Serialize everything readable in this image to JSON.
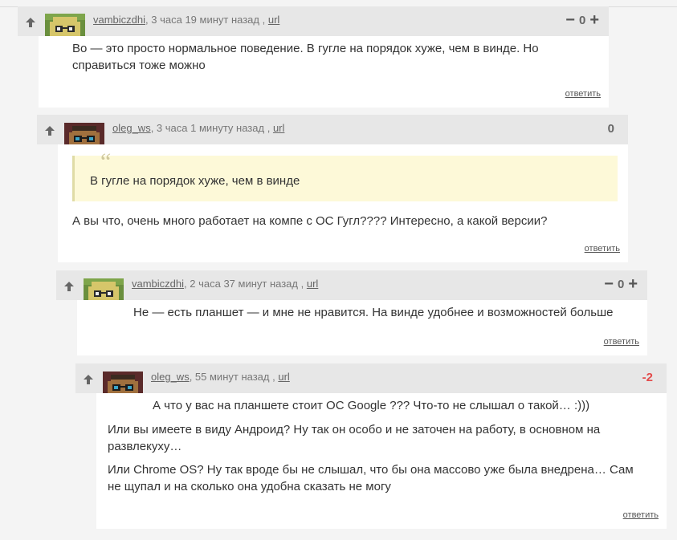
{
  "comments": [
    {
      "user": "vambiczdhi",
      "time": ", 3 часа 19 минут назад ,",
      "url": "url",
      "rating": "0",
      "has_vote_buttons": true,
      "paragraphs": [
        "Во — это просто нормальное поведение. В гугле на порядок хуже, чем в винде. Но справиться тоже можно"
      ],
      "reply": "ответить",
      "avatar": "yellow-glasses-avatar"
    },
    {
      "user": "oleg_ws",
      "time": ", 3 часа 1 минуту назад ,",
      "url": "url",
      "rating": "0",
      "has_vote_buttons": false,
      "quote": "В гугле на порядок хуже, чем в винде",
      "paragraphs": [
        "А вы что, очень много работает на компе с ОС Гугл???? Интересно, а какой версии?"
      ],
      "reply": "ответить",
      "avatar": "brown-glasses-avatar"
    },
    {
      "user": "vambiczdhi",
      "time": ", 2 часа 37 минут назад ,",
      "url": "url",
      "rating": "0",
      "has_vote_buttons": true,
      "paragraphs": [
        "Не — есть планшет — и мне не нравится. На винде удобнее и возможностей больше"
      ],
      "reply": "ответить",
      "avatar": "yellow-glasses-avatar"
    },
    {
      "user": "oleg_ws",
      "time": ", 55 минут назад ,",
      "url": "url",
      "rating": "-2",
      "has_vote_buttons": false,
      "paragraphs": [
        "А что у вас на планшете стоит ОС Google ??? Что-то не слышал о такой… :)))",
        "Или вы имеете в виду Андроид? Ну так он особо и не заточен на работу, в основном на развлекуху…",
        "Или Chrome OS? Ну так вроде бы не слышал, что бы она массово уже была внедрена… Сам не щупал и на сколько она удобна сказать не могу"
      ],
      "reply": "ответить",
      "avatar": "brown-glasses-avatar"
    }
  ],
  "colors": {
    "header_bg": "#e7e7e7",
    "body_bg": "#ffffff",
    "page_bg": "#f4f4f4",
    "quote_bg": "#fdf9d8",
    "negative": "#e34b4b",
    "online": "#3cb043"
  }
}
